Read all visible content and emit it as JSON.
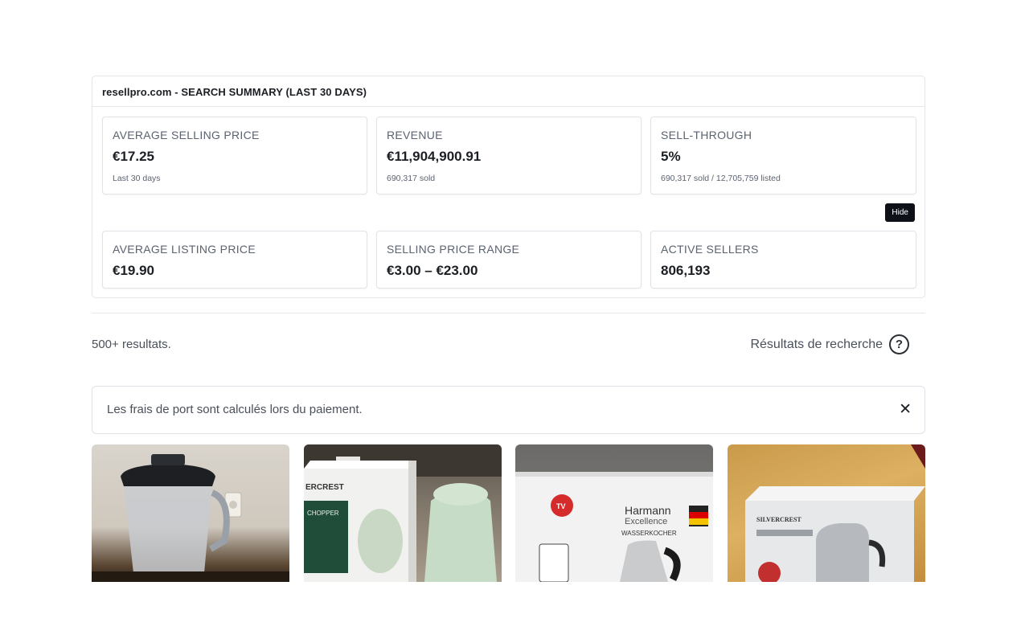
{
  "summary": {
    "title": "resellpro.com - SEARCH SUMMARY (LAST 30 DAYS)",
    "hide_label": "Hide",
    "cards": [
      {
        "label": "AVERAGE SELLING PRICE",
        "value": "€17.25",
        "sub": "Last 30 days"
      },
      {
        "label": "REVENUE",
        "value": "€11,904,900.91",
        "sub": "690,317 sold"
      },
      {
        "label": "SELL-THROUGH",
        "value": "5%",
        "sub": "690,317 sold / 12,705,759 listed"
      },
      {
        "label": "AVERAGE LISTING PRICE",
        "value": "€19.90"
      },
      {
        "label": "SELLING PRICE RANGE",
        "value": "€3.00 – €23.00"
      },
      {
        "label": "ACTIVE SELLERS",
        "value": "806,193"
      }
    ]
  },
  "results": {
    "count_text": "500+ resultats.",
    "title": "Résultats de recherche",
    "help_glyph": "?"
  },
  "notice": {
    "text": "Les frais de port sont calculés lors du paiement.",
    "close_glyph": "✕"
  },
  "products": [
    {
      "photo_text": ""
    },
    {
      "photo_text": "ERCREST"
    },
    {
      "photo_text": "Harmann"
    },
    {
      "photo_text": "SILVERCREST"
    }
  ],
  "photo_labels": {
    "p2_line": "CHOPPER",
    "p3_line1": "Excellence",
    "p3_line2": "WASSERKOCHER",
    "p3_badge": "TV"
  }
}
